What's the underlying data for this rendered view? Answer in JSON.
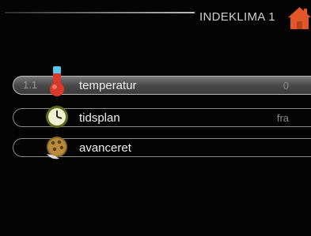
{
  "header": {
    "title": "INDEKLIMA 1",
    "home_icon": "home-icon",
    "accent_color": "#e2572a"
  },
  "menu": {
    "items": [
      {
        "number": "1.1",
        "label": "temperatur",
        "value": "0",
        "icon": "thermometer-icon",
        "selected": true
      },
      {
        "number": "",
        "label": "tidsplan",
        "value": "fra",
        "icon": "clock-icon",
        "selected": false
      },
      {
        "number": "",
        "label": "avanceret",
        "value": "",
        "icon": "advanced-icon",
        "selected": false
      }
    ]
  }
}
